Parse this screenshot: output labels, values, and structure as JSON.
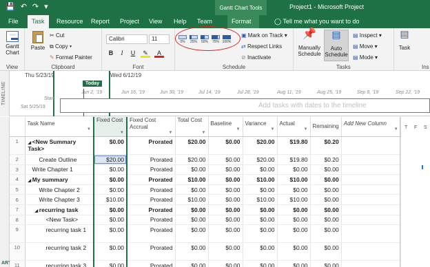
{
  "titlebar": {
    "context_tab": "Gantt Chart Tools",
    "title": "Project1  -  Microsoft Project",
    "qat_icons": [
      "save-icon",
      "undo-icon",
      "redo-icon",
      "customize-icon"
    ]
  },
  "tabs": [
    {
      "label": "File"
    },
    {
      "label": "Task"
    },
    {
      "label": "Resource"
    },
    {
      "label": "Report"
    },
    {
      "label": "Project"
    },
    {
      "label": "View"
    },
    {
      "label": "Help"
    },
    {
      "label": "Team"
    },
    {
      "label": "Format"
    }
  ],
  "tell_me": "Tell me what you want to do",
  "ribbon": {
    "view": {
      "button": "Gantt Chart",
      "label": "View"
    },
    "clipboard": {
      "paste": "Paste",
      "cut": "Cut",
      "copy": "Copy",
      "format_painter": "Format Painter",
      "label": "Clipboard"
    },
    "font": {
      "family": "Calibri",
      "size": "11",
      "bold": "B",
      "italic": "I",
      "underline": "U",
      "label": "Font"
    },
    "schedule": {
      "percent_buttons": [
        {
          "label": "0%",
          "value": 0
        },
        {
          "label": "25%",
          "value": 25
        },
        {
          "label": "50%",
          "value": 50
        },
        {
          "label": "75%",
          "value": 75
        },
        {
          "label": "100%",
          "value": 100
        }
      ],
      "mark_on_track": "Mark on Track",
      "respect_links": "Respect Links",
      "inactivate": "Inactivate",
      "label": "Schedule"
    },
    "tasks": {
      "manually": "Manually Schedule",
      "auto": "Auto Schedule",
      "inspect": "Inspect",
      "move": "Move",
      "mode": "Mode",
      "task": "Task",
      "label": "Tasks",
      "ins": "Ins"
    }
  },
  "timeline": {
    "side_label": "TIMELINE",
    "date_left": "Thu 5/23/19",
    "date_right": "Wed 6/12/19",
    "today": "Today",
    "ticks": [
      "Jun 2, '19",
      "Jun 16, '19",
      "Jun 30, '19",
      "Jul 14, '19",
      "Jul 28, '19",
      "Aug 11, '19",
      "Aug 25, '19",
      "Sep 8, '19",
      "Sep 22, '19"
    ],
    "start_label": "Start",
    "start_date": "Sat 5/25/19",
    "hint": "Add tasks with dates to the timeline"
  },
  "grid": {
    "side_label": "ART",
    "columns": [
      "Task Name",
      "Fixed Cost",
      "Fixed Cost Accrual",
      "Total Cost",
      "Baseline",
      "Variance",
      "Actual",
      "Remaining",
      "Add New Column"
    ],
    "rows": [
      {
        "id": "1",
        "name": "<New Summary Task>",
        "fixed_cost": "$0.00",
        "accrual": "Prorated",
        "total": "$20.00",
        "baseline": "$0.00",
        "variance": "$20.00",
        "actual": "$19.80",
        "remaining": "$0.20"
      },
      {
        "id": "2",
        "name": "Create Outline",
        "fixed_cost": "$20.00",
        "accrual": "Prorated",
        "total": "$20.00",
        "baseline": "$0.00",
        "variance": "$20.00",
        "actual": "$19.80",
        "remaining": "$0.20"
      },
      {
        "id": "3",
        "name": "Write Chapter 1",
        "fixed_cost": "$0.00",
        "accrual": "Prorated",
        "total": "$0.00",
        "baseline": "$0.00",
        "variance": "$0.00",
        "actual": "$0.00",
        "remaining": "$0.00"
      },
      {
        "id": "4",
        "name": "My summary",
        "fixed_cost": "$0.00",
        "accrual": "Prorated",
        "total": "$10.00",
        "baseline": "$0.00",
        "variance": "$10.00",
        "actual": "$10.00",
        "remaining": "$0.00"
      },
      {
        "id": "5",
        "name": "Write Chapter 2",
        "fixed_cost": "$0.00",
        "accrual": "Prorated",
        "total": "$0.00",
        "baseline": "$0.00",
        "variance": "$0.00",
        "actual": "$0.00",
        "remaining": "$0.00"
      },
      {
        "id": "6",
        "name": "Write Chapter 3",
        "fixed_cost": "$10.00",
        "accrual": "Prorated",
        "total": "$10.00",
        "baseline": "$0.00",
        "variance": "$10.00",
        "actual": "$10.00",
        "remaining": "$0.00"
      },
      {
        "id": "7",
        "name": "recurring task",
        "fixed_cost": "$0.00",
        "accrual": "Prorated",
        "total": "$0.00",
        "baseline": "$0.00",
        "variance": "$0.00",
        "actual": "$0.00",
        "remaining": "$0.00"
      },
      {
        "id": "8",
        "name": "<New Task>",
        "fixed_cost": "$0.00",
        "accrual": "Prorated",
        "total": "$0.00",
        "baseline": "$0.00",
        "variance": "$0.00",
        "actual": "$0.00",
        "remaining": "$0.00"
      },
      {
        "id": "9",
        "name": "recurring task 1",
        "fixed_cost": "$0.00",
        "accrual": "Prorated",
        "total": "$0.00",
        "baseline": "$0.00",
        "variance": "$0.00",
        "actual": "$0.00",
        "remaining": "$0.00"
      },
      {
        "id": "10",
        "name": "recurring task 2",
        "fixed_cost": "$0.00",
        "accrual": "Prorated",
        "total": "$0.00",
        "baseline": "$0.00",
        "variance": "$0.00",
        "actual": "$0.00",
        "remaining": "$0.00"
      },
      {
        "id": "11",
        "name": "recurring task 3",
        "fixed_cost": "$0.00",
        "accrual": "Prorated",
        "total": "$0.00",
        "baseline": "$0.00",
        "variance": "$0.00",
        "actual": "$0.00",
        "remaining": "$0.00"
      }
    ],
    "gantt_days": [
      "T",
      "F",
      "S"
    ]
  },
  "colors": {
    "brand": "#1e7145",
    "annotation": "#d4261e",
    "selection": "#dbe6f5"
  }
}
